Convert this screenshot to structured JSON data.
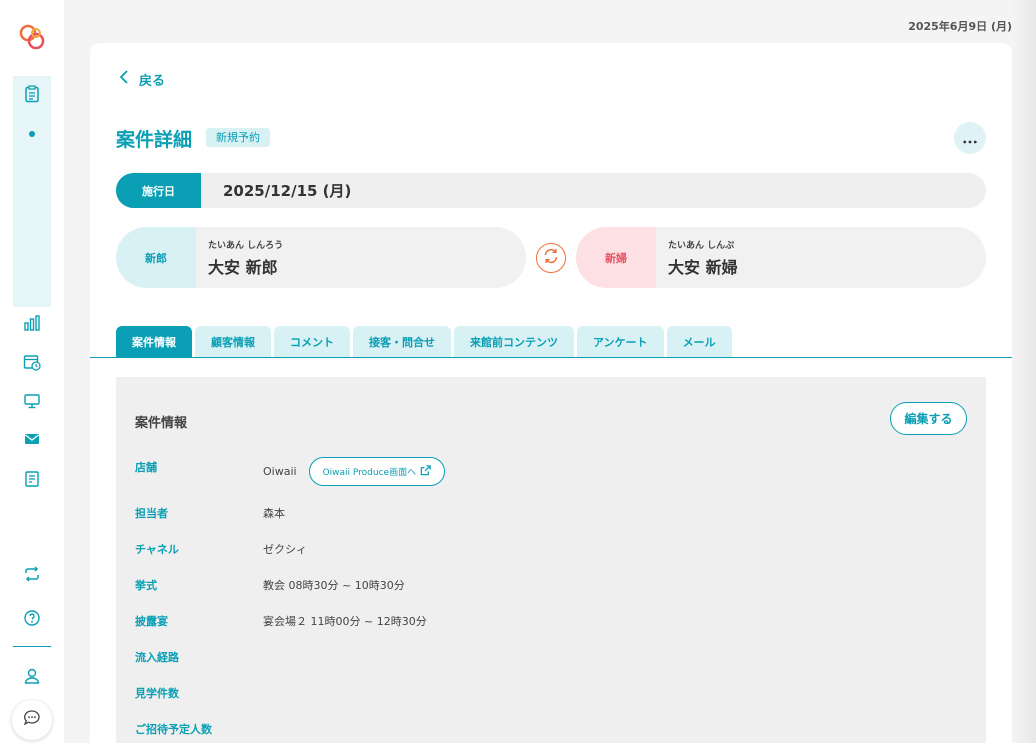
{
  "header": {
    "date": "2025年6月9日 (月)"
  },
  "sidebar": {
    "items": [
      {
        "icon": "clipboard-icon",
        "active": true
      },
      {
        "icon": "bar-chart-icon"
      },
      {
        "icon": "calendar-clock-icon"
      },
      {
        "icon": "monitor-icon"
      },
      {
        "icon": "mail-icon"
      },
      {
        "icon": "document-icon"
      },
      {
        "icon": "refresh-arrows-icon"
      },
      {
        "icon": "help-icon"
      },
      {
        "icon": "user-icon"
      },
      {
        "icon": "chat-icon"
      }
    ]
  },
  "page": {
    "back_label": "戻る",
    "title": "案件詳細",
    "status_badge": "新規予約",
    "date_label": "施行日",
    "date_value": "2025/12/15 (月)"
  },
  "groom": {
    "role": "新郎",
    "kana": "たいあん しんろう",
    "name": "大安 新郎"
  },
  "bride": {
    "role": "新婦",
    "kana": "たいあん しんぷ",
    "name": "大安 新婦"
  },
  "tabs": [
    {
      "label": "案件情報",
      "active": true
    },
    {
      "label": "顧客情報"
    },
    {
      "label": "コメント"
    },
    {
      "label": "接客・問合せ"
    },
    {
      "label": "来館前コンテンツ"
    },
    {
      "label": "アンケート"
    },
    {
      "label": "メール"
    }
  ],
  "case_info": {
    "title": "案件情報",
    "edit_label": "編集する",
    "produce_link": "Oiwaii Produce画面へ",
    "rows": [
      {
        "label": "店舗",
        "value": "Oiwaii"
      },
      {
        "label": "担当者",
        "value": "森本"
      },
      {
        "label": "チャネル",
        "value": "ゼクシィ"
      },
      {
        "label": "挙式",
        "value": "教会 08時30分 ~ 10時30分"
      },
      {
        "label": "披露宴",
        "value": "宴会場２ 11時00分 ~ 12時30分"
      },
      {
        "label": "流入経路",
        "value": ""
      },
      {
        "label": "見学件数",
        "value": ""
      },
      {
        "label": "ご招待予定人数",
        "value": ""
      }
    ]
  },
  "colors": {
    "accent": "#0a9fb5",
    "bride": "#e8505f",
    "swap": "#ef6f3c"
  }
}
